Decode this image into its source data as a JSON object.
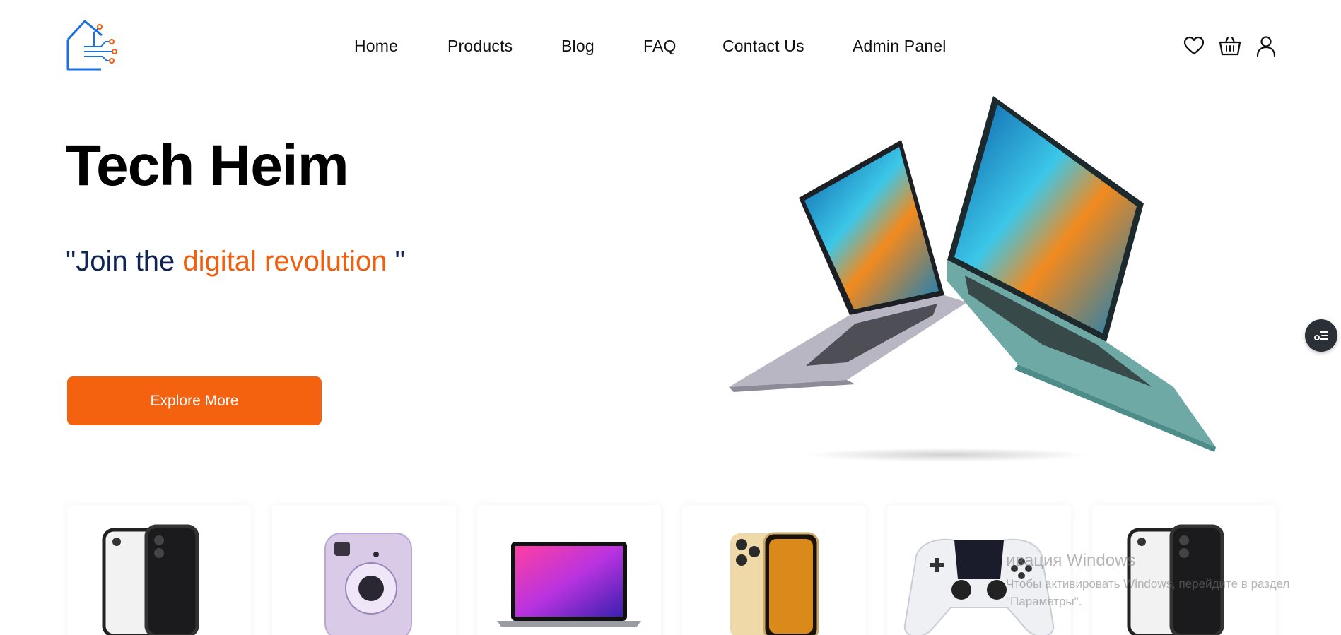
{
  "header": {
    "logo_icon": "circuit-house-logo",
    "nav": [
      {
        "label": "Home"
      },
      {
        "label": "Products"
      },
      {
        "label": "Blog"
      },
      {
        "label": "FAQ"
      },
      {
        "label": "Contact Us"
      },
      {
        "label": "Admin Panel"
      }
    ],
    "icons": [
      "heart-icon",
      "basket-icon",
      "user-icon"
    ]
  },
  "hero": {
    "title": "Tech Heim",
    "tagline_open": "\"Join the ",
    "tagline_accent": "digital revolution",
    "tagline_close": " \"",
    "cta_label": "Explore More",
    "image": "two-laptops-image"
  },
  "colors": {
    "accent": "#f4620f",
    "tagline_dark": "#0f2356",
    "brand_blue": "#1d6fe0"
  },
  "products": [
    {
      "image": "iphone-clear-case-image"
    },
    {
      "image": "instax-camera-image"
    },
    {
      "image": "macbook-image"
    },
    {
      "image": "iphone-gold-image"
    },
    {
      "image": "gamepad-image"
    },
    {
      "image": "iphone-clear-case-image"
    }
  ],
  "floating_button": {
    "icon": "filter-list-icon"
  },
  "watermark": {
    "title": "ивация Windows",
    "line1": "Чтобы активировать Windows, перейдите в раздел",
    "line2": "\"Параметры\"."
  }
}
